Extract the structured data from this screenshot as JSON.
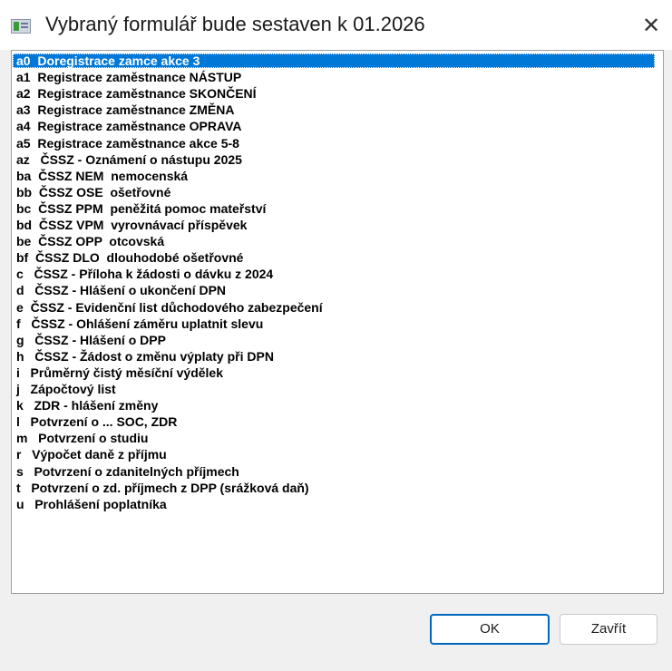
{
  "window": {
    "title": "Vybraný formulář bude sestaven k 01.2026",
    "close_glyph": "✕"
  },
  "list": {
    "selected_index": 0,
    "items": [
      "a0  Doregistrace zamce akce 3",
      "a1  Registrace zaměstnance NÁSTUP",
      "a2  Registrace zaměstnance SKONČENÍ",
      "a3  Registrace zaměstnance ZMĚNA",
      "a4  Registrace zaměstnance OPRAVA",
      "a5  Registrace zaměstnance akce 5-8",
      "az   ČSSZ - Oznámení o nástupu 2025",
      "ba  ČSSZ NEM  nemocenská",
      "bb  ČSSZ OSE  ošetřovné",
      "bc  ČSSZ PPM  peněžitá pomoc mateřství",
      "bd  ČSSZ VPM  vyrovnávací příspěvek",
      "be  ČSSZ OPP  otcovská",
      "bf  ČSSZ DLO  dlouhodobé ošetřovné",
      "c   ČSSZ - Příloha k žádosti o dávku z 2024",
      "d   ČSSZ - Hlášení o ukončení DPN",
      "e  ČSSZ - Evidenční list důchodového zabezpečení",
      "f   ČSSZ - Ohlášení záměru uplatnit slevu",
      "g   ČSSZ - Hlášení o DPP",
      "h   ČSSZ - Žádost o změnu výplaty při DPN",
      "i   Průměrný čistý měsíční výdělek",
      "j   Zápočtový list",
      "k   ZDR - hlášení změny",
      "l   Potvrzení o ... SOC, ZDR",
      "m   Potvrzení o studiu",
      "r   Výpočet daně z příjmu",
      "s   Potvrzení o zdanitelných příjmech",
      "t   Potvrzení o zd. příjmech z DPP (srážková daň)",
      "u   Prohlášení poplatníka"
    ]
  },
  "buttons": {
    "ok": "OK",
    "close": "Zavřít"
  },
  "colors": {
    "selection": "#0078d7",
    "default_button_border": "#0067c0"
  }
}
